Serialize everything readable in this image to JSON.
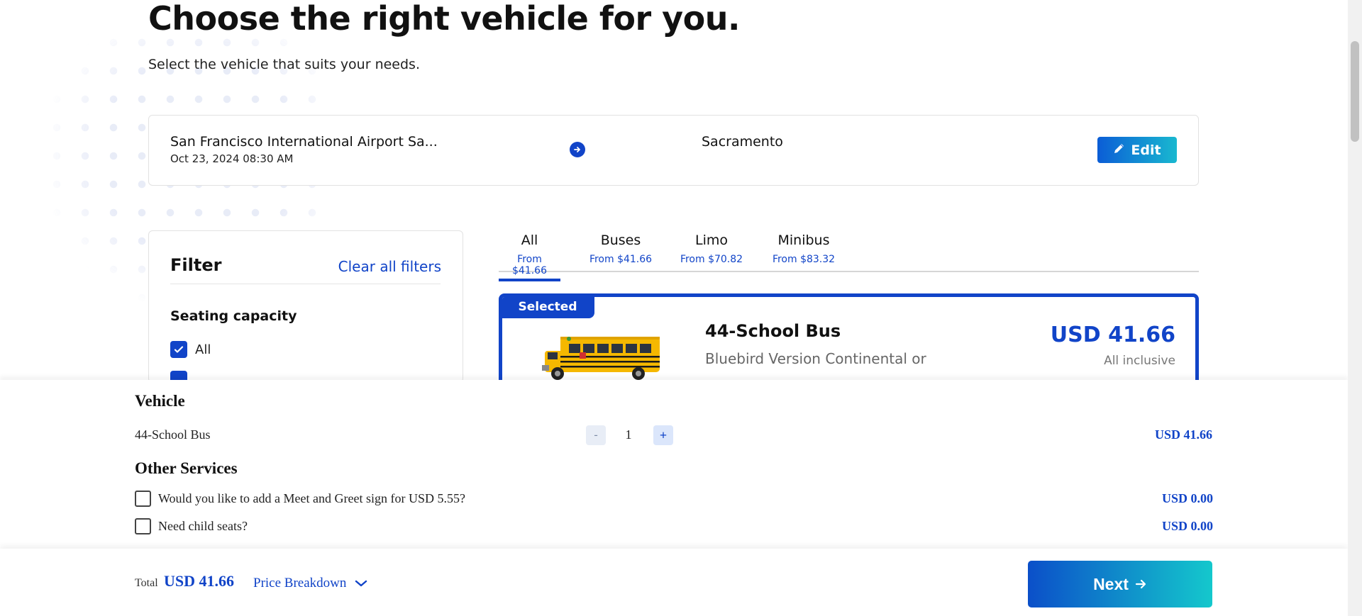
{
  "header": {
    "title": "Choose the right vehicle for you.",
    "subtitle": "Select the vehicle that suits your needs."
  },
  "route": {
    "from": "San Francisco International Airport Sa...",
    "date": "Oct 23, 2024 08:30 AM",
    "to": "Sacramento",
    "edit_label": "Edit"
  },
  "filter": {
    "title": "Filter",
    "clear_label": "Clear all filters",
    "seating_title": "Seating capacity",
    "options": [
      {
        "label": "All",
        "checked": true
      }
    ]
  },
  "tabs": [
    {
      "label": "All",
      "price": "From $41.66",
      "active": true
    },
    {
      "label": "Buses",
      "price": "From $41.66",
      "active": false
    },
    {
      "label": "Limo",
      "price": "From $70.82",
      "active": false
    },
    {
      "label": "Minibus",
      "price": "From $83.32",
      "active": false
    }
  ],
  "vehicle_card": {
    "selected_label": "Selected",
    "name": "44-School Bus",
    "description": "Bluebird Version Continental or",
    "price": "USD 41.66",
    "price_note": "All inclusive"
  },
  "summary": {
    "vehicle_heading": "Vehicle",
    "vehicle_name": "44-School Bus",
    "quantity_minus": "-",
    "quantity": "1",
    "quantity_plus": "+",
    "vehicle_price": "USD 41.66",
    "other_heading": "Other Services",
    "services": [
      {
        "label": "Would you like to add a Meet and Greet sign for USD 5.55?",
        "price": "USD 0.00",
        "checked": false
      },
      {
        "label": "Need child seats?",
        "price": "USD 0.00",
        "checked": false
      }
    ]
  },
  "footer": {
    "total_label": "Total",
    "total_value": "USD 41.66",
    "breakdown_label": "Price Breakdown",
    "next_label": "Next"
  },
  "colors": {
    "primary": "#1144c8",
    "gradient_start": "#0b4fc9",
    "gradient_end": "#14c8cc"
  },
  "icons": {
    "route_arrow": "arrow-right-circle-icon",
    "edit": "pencil-icon",
    "checkbox": "checkmark-icon",
    "breakdown": "chevron-down-icon",
    "next": "arrow-right-icon"
  }
}
